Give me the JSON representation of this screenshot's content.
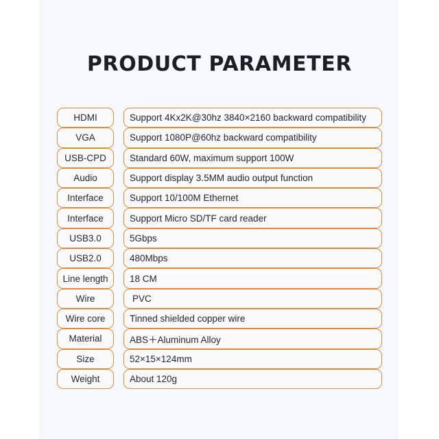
{
  "page": {
    "title": "PRODUCT PARAMETER",
    "background_color": "#f5f8fd",
    "accent_color": "#e08a3c",
    "text_color": "#22262e",
    "title_color": "#1a1e26"
  },
  "table": {
    "rows": [
      {
        "label": "HDMI",
        "value": "Support 4Kx2K@30hz 3840×2160 backward compatibility"
      },
      {
        "label": "VGA",
        "value": "Support 1080P@60hz backward compatibility"
      },
      {
        "label": "USB-CPD",
        "value": "Standard 60W, maximum support 100W"
      },
      {
        "label": "Audio",
        "value": "Support display 3.5MM audio output function"
      },
      {
        "label": "Interface",
        "value": "Support 10/100M Ethernet"
      },
      {
        "label": "Interface",
        "value": "Support Micro SD/TF card reader"
      },
      {
        "label": "USB3.0",
        "value": "5Gbps"
      },
      {
        "label": "USB2.0",
        "value": "480Mbps"
      },
      {
        "label": "Line length",
        "value": "18 CM"
      },
      {
        "label": "Wire",
        "value": "PVC"
      },
      {
        "label": "Wire core",
        "value": "Tinned shielded copper wire"
      },
      {
        "label": "Material",
        "value": "ABS＋Aluminum Alloy"
      },
      {
        "label": "Size",
        "value": "52×15×124mm"
      },
      {
        "label": "Weight",
        "value": "About 120g"
      }
    ]
  }
}
